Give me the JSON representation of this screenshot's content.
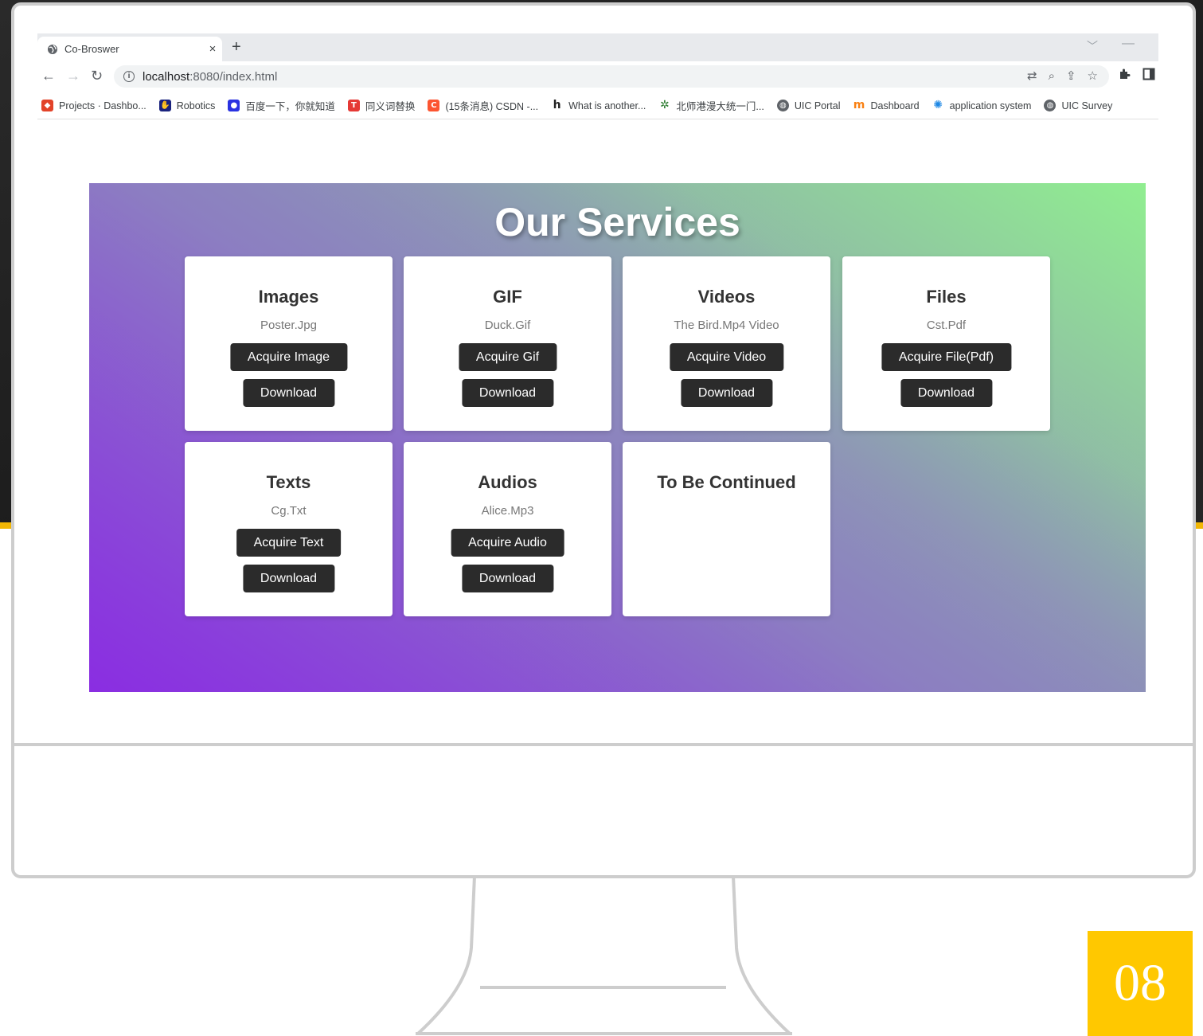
{
  "browser": {
    "tab_title": "Co-Broswer",
    "tab_close": "×",
    "new_tab": "+",
    "url_host": "localhost",
    "url_rest": ":8080/index.html",
    "bookmarks": [
      {
        "label": "Projects · Dashbo...",
        "icon": "gitlab-icon",
        "color": "#e24329"
      },
      {
        "label": "Robotics",
        "icon": "robot-hand-icon",
        "color": "#1a237e"
      },
      {
        "label": "百度一下，你就知道",
        "icon": "baidu-paw-icon",
        "color": "#2932e1"
      },
      {
        "label": "同义词替换",
        "icon": "t-logo-icon",
        "color": "#e53935"
      },
      {
        "label": "(15条消息) CSDN -...",
        "icon": "csdn-c-icon",
        "color": "#fc5531"
      },
      {
        "label": "What is another...",
        "icon": "h-logo-icon",
        "color": "#222222"
      },
      {
        "label": "北师港漫大统一门...",
        "icon": "green-star-icon",
        "color": "#2e7d32"
      },
      {
        "label": "UIC Portal",
        "icon": "globe-icon",
        "color": "#5f6368"
      },
      {
        "label": "Dashboard",
        "icon": "moodle-m-icon",
        "color": "#f98012"
      },
      {
        "label": "application system",
        "icon": "gear-flower-icon",
        "color": "#1e88e5"
      },
      {
        "label": "UIC Survey",
        "icon": "globe-icon",
        "color": "#5f6368"
      }
    ]
  },
  "page": {
    "title": "Our Services",
    "cards": [
      {
        "title": "Images",
        "file": "Poster.Jpg",
        "acquire": "Acquire Image",
        "download": "Download"
      },
      {
        "title": "GIF",
        "file": "Duck.Gif",
        "acquire": "Acquire Gif",
        "download": "Download"
      },
      {
        "title": "Videos",
        "file": "The Bird.Mp4 Video",
        "acquire": "Acquire Video",
        "download": "Download"
      },
      {
        "title": "Files",
        "file": "Cst.Pdf",
        "acquire": "Acquire File(Pdf)",
        "download": "Download"
      },
      {
        "title": "Texts",
        "file": "Cg.Txt",
        "acquire": "Acquire Text",
        "download": "Download"
      },
      {
        "title": "Audios",
        "file": "Alice.Mp3",
        "acquire": "Acquire Audio",
        "download": "Download"
      },
      {
        "title": "To Be Continued"
      }
    ]
  },
  "slide": {
    "number": "08",
    "accent": "#ffc800"
  }
}
